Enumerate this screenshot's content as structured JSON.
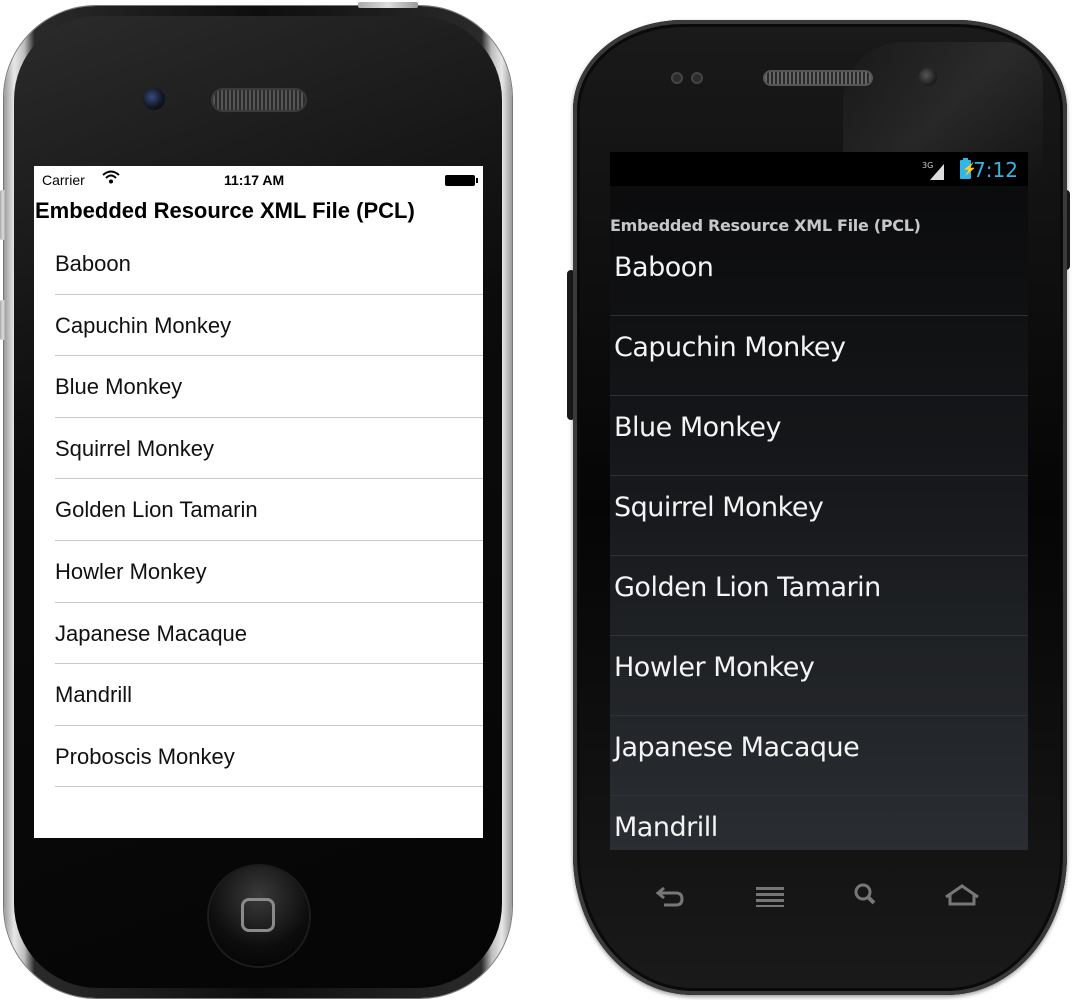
{
  "ios": {
    "status": {
      "carrier": "Carrier",
      "time": "11:17 AM"
    },
    "title": "Embedded Resource XML File (PCL)",
    "items": [
      "Baboon",
      "Capuchin Monkey",
      "Blue Monkey",
      "Squirrel Monkey",
      "Golden Lion Tamarin",
      "Howler Monkey",
      "Japanese Macaque",
      "Mandrill",
      "Proboscis Monkey"
    ]
  },
  "android": {
    "status": {
      "time": "7:12",
      "network": "3G"
    },
    "title": "Embedded Resource XML File (PCL)",
    "items": [
      "Baboon",
      "Capuchin Monkey",
      "Blue Monkey",
      "Squirrel Monkey",
      "Golden Lion Tamarin",
      "Howler Monkey",
      "Japanese Macaque",
      "Mandrill"
    ],
    "accent_color": "#33b5e5",
    "nav_icons": [
      "back-icon",
      "menu-icon",
      "search-icon",
      "home-icon"
    ]
  }
}
